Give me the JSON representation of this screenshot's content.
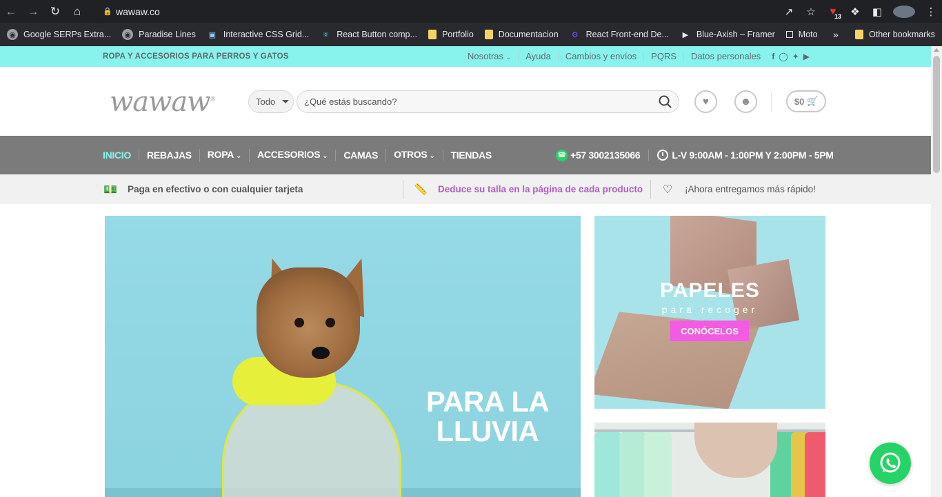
{
  "browser": {
    "url": "wawaw.co",
    "extension_badge": "13",
    "bookmarks": [
      {
        "label": "Google SERPs Extra...",
        "icon": "globe-icon"
      },
      {
        "label": "Paradise Lines",
        "icon": "globe-icon"
      },
      {
        "label": "Interactive CSS Grid...",
        "icon": "cube-icon"
      },
      {
        "label": "React Button comp...",
        "icon": "react-icon"
      },
      {
        "label": "Portfolio",
        "icon": "folder-icon"
      },
      {
        "label": "Documentacion",
        "icon": "folder-icon"
      },
      {
        "label": "React Front-end De...",
        "icon": "rf-icon"
      },
      {
        "label": "Blue-Axish – Framer",
        "icon": "framer-icon"
      },
      {
        "label": "Moto",
        "icon": "square-icon"
      }
    ],
    "other_bookmarks": "Other bookmarks"
  },
  "topbar": {
    "tagline": "ROPA Y ACCESORIOS PARA PERROS Y GATOS",
    "links": [
      "Nosotras",
      "Ayuda",
      "Cambios y envíos",
      "PQRS",
      "Datos personales"
    ],
    "bg_color": "#88f3ec"
  },
  "header": {
    "logo": "wawaw",
    "category_select": "Todo",
    "search_placeholder": "¿Qué estás buscando?",
    "cart": "$0"
  },
  "mainnav": {
    "items": [
      {
        "label": "INICIO"
      },
      {
        "label": "REBAJAS"
      },
      {
        "label": "ROPA"
      },
      {
        "label": "ACCESORIOS"
      },
      {
        "label": "CAMAS"
      },
      {
        "label": "OTROS"
      },
      {
        "label": "TIENDAS"
      }
    ],
    "phone": "+57 3002135066",
    "hours": "L-V 9:00AM - 1:00PM Y 2:00PM - 5PM"
  },
  "benefits": [
    {
      "label": "Paga en efectivo o con cualquier tarjeta",
      "icon": "cash-icon"
    },
    {
      "label": "Deduce su talla en la página de cada producto",
      "icon": "ruler-icon"
    },
    {
      "label": "¡Ahora entregamos más rápido!",
      "icon": "heart-icon"
    }
  ],
  "hero": {
    "title_line1": "PARA LA",
    "title_line2": "LLUVIA"
  },
  "promo_papeles": {
    "title": "PAPELES",
    "subtitle": "para recoger",
    "button": "CONÓCELOS",
    "button_color": "#f35be3"
  }
}
